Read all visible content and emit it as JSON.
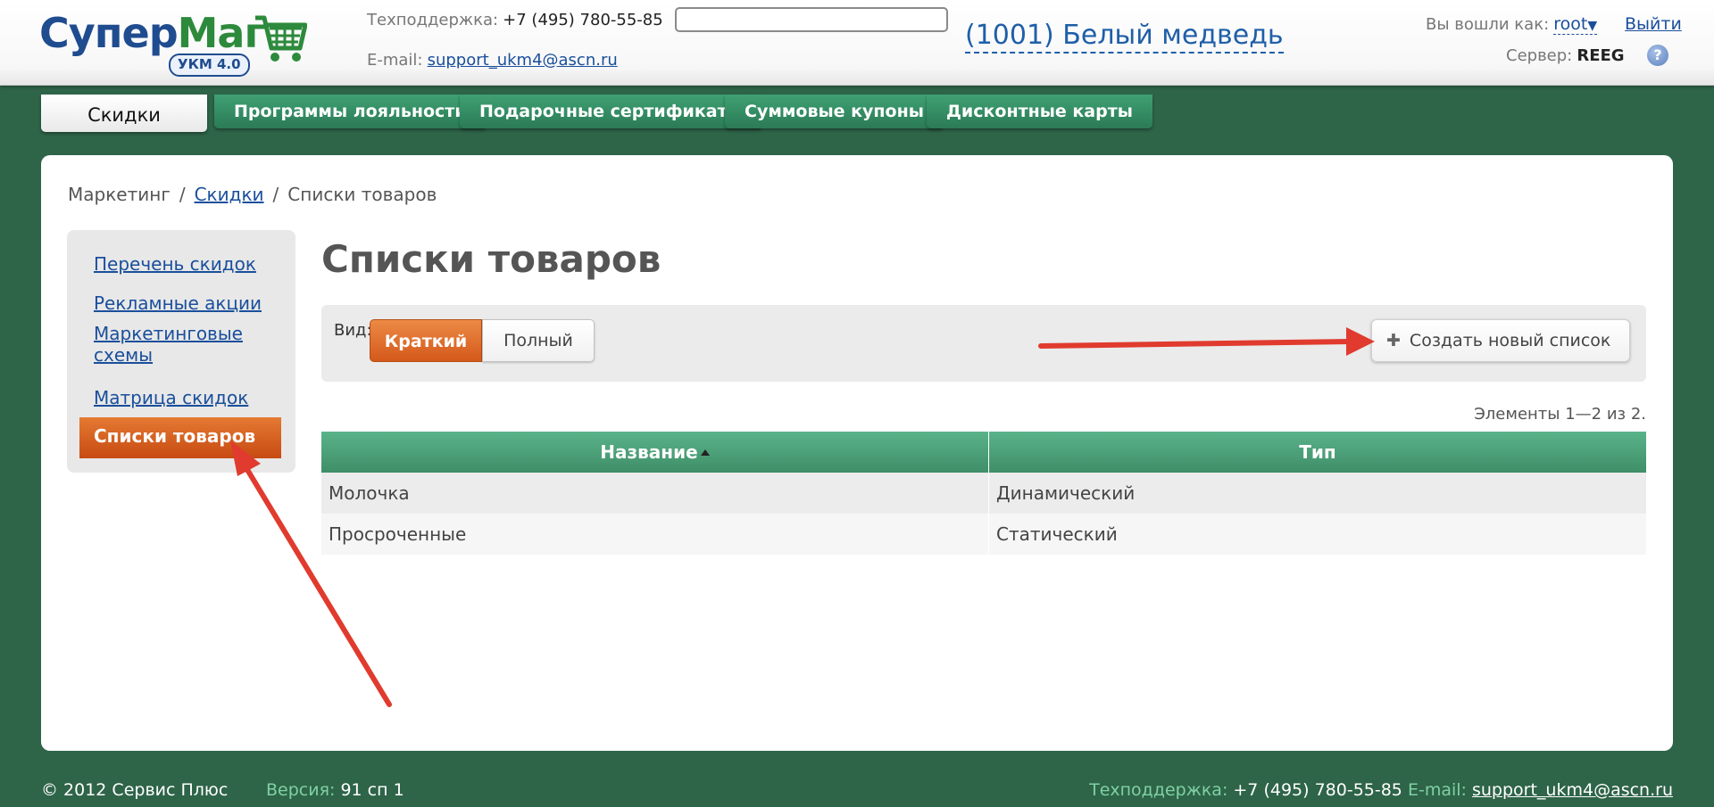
{
  "header": {
    "logo": {
      "part1": "Супер",
      "part2": "Маг",
      "badge": "УКМ 4.0"
    },
    "support_label": "Техподдержка:",
    "support_phone": "+7 (495) 780-55-85",
    "email_label": "E-mail:",
    "email": "support_ukm4@ascn.ru",
    "search_value": "",
    "store_name": "(1001) Белый медведь",
    "login_label": "Вы вошли как:",
    "user": "root",
    "logout": "Выйти",
    "server_label": "Сервер:",
    "server": "REEG",
    "help": "?"
  },
  "tabs": [
    {
      "label": "Скидки",
      "active": true
    },
    {
      "label": "Программы лояльности"
    },
    {
      "label": "Подарочные сертификаты"
    },
    {
      "label": "Суммовые купоны"
    },
    {
      "label": "Дисконтные карты"
    }
  ],
  "breadcrumb": {
    "root": "Маркетинг",
    "link": "Скидки",
    "current": "Списки товаров",
    "separator": "/"
  },
  "sidebar": {
    "items": [
      {
        "label": "Перечень скидок"
      },
      {
        "label": "Рекламные акции"
      },
      {
        "label": "Маркетинговые схемы"
      },
      {
        "label": "Матрица скидок"
      }
    ],
    "active": "Списки товаров"
  },
  "main": {
    "title": "Списки товаров",
    "view_label": "Вид:",
    "view_brief": "Краткий",
    "view_full": "Полный",
    "create_button": "Создать новый список",
    "items_count": "Элементы 1—2 из 2.",
    "table": {
      "columns": [
        "Название",
        "Тип"
      ],
      "rows": [
        [
          "Молочка",
          "Динамический"
        ],
        [
          "Просроченные",
          "Статический"
        ]
      ]
    }
  },
  "footer": {
    "copyright": "© 2012 Сервис Плюс",
    "version_label": "Версия:",
    "version": "91 сп 1",
    "support_label": "Техподдержка:",
    "support_phone": "+7 (495) 780-55-85",
    "email_label": "E-mail:",
    "email": "support_ukm4@ascn.ru"
  },
  "colors": {
    "background": "#2e6448",
    "tab": "#3a9169",
    "accent_orange": "#d85e1f",
    "table_header": "#4fa47c",
    "link": "#1a4f9c",
    "annotation_arrow": "#e03b2e"
  }
}
